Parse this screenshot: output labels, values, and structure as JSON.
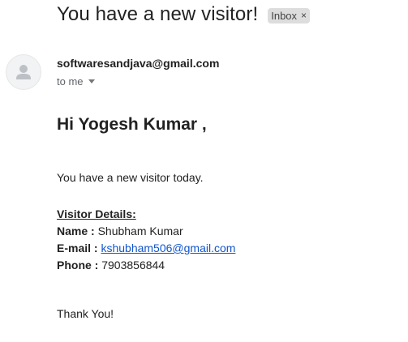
{
  "email": {
    "subject": "You have a new visitor!",
    "label_chip": "Inbox",
    "label_chip_close": "×",
    "sender": "softwaresandjava@gmail.com",
    "recipient": "to me"
  },
  "message": {
    "greeting": "Hi Yogesh Kumar ,",
    "intro": "You have a new visitor today.",
    "details_heading": "Visitor Details:",
    "name_label": "Name :",
    "name_value": "Shubham Kumar",
    "email_label": "E-mail :",
    "email_value": "kshubham506@gmail.com",
    "phone_label": "Phone :",
    "phone_value": "7903856844",
    "closing": "Thank You!"
  },
  "colors": {
    "link": "#1155cc",
    "chip_background": "#dddddd",
    "secondary_text": "#5f6368"
  },
  "icons": {
    "avatar": "person-icon",
    "recipient_dropdown": "caret-down-icon",
    "chip_remove": "close-icon"
  }
}
